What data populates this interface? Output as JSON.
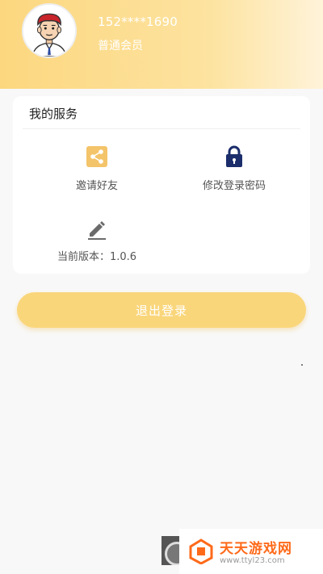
{
  "header": {
    "phone": "152****1690",
    "member_level": "普通会员"
  },
  "services": {
    "title": "我的服务",
    "items": [
      {
        "label": "邀请好友",
        "icon": "share-icon"
      },
      {
        "label": "修改登录密码",
        "icon": "lock-icon"
      },
      {
        "label": "当前版本：1.0.6",
        "icon": "edit-icon"
      }
    ]
  },
  "logout": {
    "label": "退出登录"
  },
  "watermark": {
    "title": "天天游戏网",
    "url": "www.ttyl23.com"
  },
  "colors": {
    "accent": "#fad67b",
    "header_gradient_start": "#fcd77f",
    "lock_blue": "#1b2d6b",
    "share_bg": "#f4c46a",
    "watermark_orange": "#ff6a1a"
  }
}
